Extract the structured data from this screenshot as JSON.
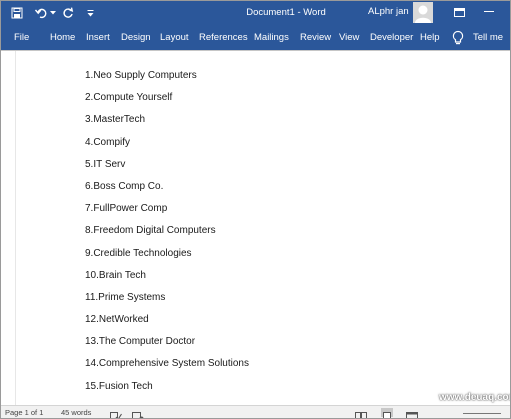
{
  "titlebar": {
    "doc_title": "Document1  -  Word",
    "user_name": "ALphr jan"
  },
  "tabs": [
    {
      "label": "File"
    },
    {
      "label": "Home"
    },
    {
      "label": "Insert"
    },
    {
      "label": "Design"
    },
    {
      "label": "Layout"
    },
    {
      "label": "References"
    },
    {
      "label": "Mailings"
    },
    {
      "label": "Review"
    },
    {
      "label": "View"
    },
    {
      "label": "Developer"
    },
    {
      "label": "Help"
    },
    {
      "label": "Tell me"
    }
  ],
  "document": {
    "lines": [
      "1.Neo Supply Computers",
      "2.Compute Yourself",
      "3.MasterTech",
      "4.Compify",
      "5.IT Serv",
      "6.Boss Comp Co.",
      "7.FullPower Comp",
      "8.Freedom Digital Computers",
      "9.Credible Technologies",
      "10.Brain Tech",
      "11.Prime Systems",
      "12.NetWorked",
      "13.The Computer Doctor",
      "14.Comprehensive System Solutions",
      "15.Fusion Tech"
    ]
  },
  "status": {
    "page": "Page 1 of 1",
    "words": "45 words"
  },
  "watermark": "www.deuaq.com",
  "colors": {
    "ribbon": "#2b579a",
    "status_bg": "#f1f1f1"
  }
}
